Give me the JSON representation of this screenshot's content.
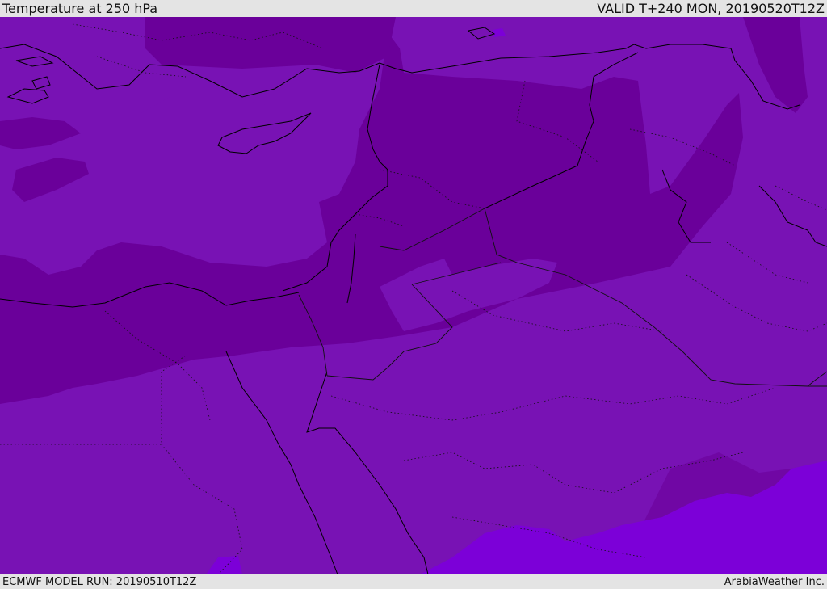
{
  "header": {
    "title": "Temperature at 250 hPa",
    "valid": "VALID T+240 MON, 20190520T12Z"
  },
  "footer": {
    "model_run": "ECMWF MODEL RUN: 20190510T12Z",
    "credit": "ArabiaWeather Inc."
  },
  "colors": {
    "level_base": "#7812b4",
    "level_cold": "#6a009a",
    "level_warm": "#7c00d8",
    "coast": "#000000",
    "border": "#111111"
  }
}
